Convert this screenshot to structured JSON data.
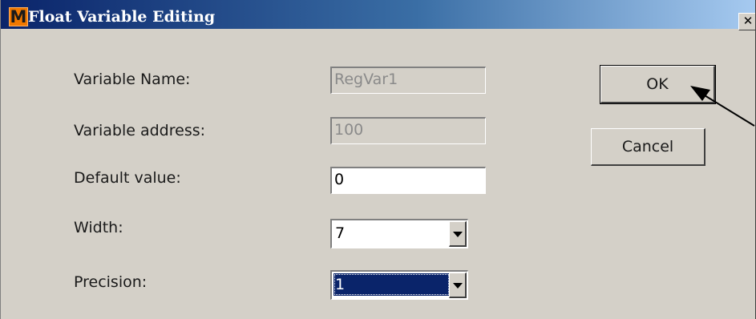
{
  "window": {
    "icon_letter": "M",
    "title": "Float Variable Editing",
    "close_glyph": "✕"
  },
  "form": {
    "variable_name": {
      "label": "Variable Name:",
      "value": "RegVar1",
      "enabled": false
    },
    "variable_address": {
      "label": "Variable address:",
      "value": "100",
      "enabled": false
    },
    "default_value": {
      "label": "Default value:",
      "value": "0",
      "enabled": true
    },
    "width": {
      "label": "Width:",
      "value": "7"
    },
    "precision": {
      "label": "Precision:",
      "value": "1"
    }
  },
  "buttons": {
    "ok": "OK",
    "cancel": "Cancel"
  },
  "colors": {
    "titlebar_start": "#0a246a",
    "dialog_bg": "#d4d0c8",
    "selection": "#0a246a",
    "app_icon": "#f07800"
  },
  "icons": [
    "app-logo-icon",
    "close-icon",
    "chevron-down-icon",
    "arrow-pointer-icon"
  ]
}
